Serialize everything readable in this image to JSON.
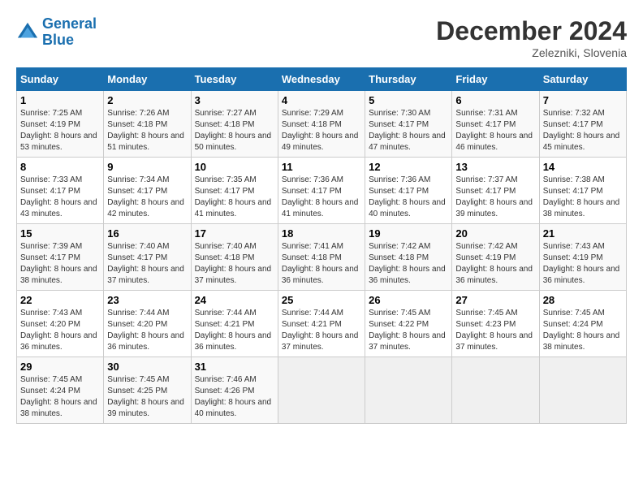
{
  "logo": {
    "line1": "General",
    "line2": "Blue"
  },
  "title": "December 2024",
  "subtitle": "Zelezniki, Slovenia",
  "days_header": [
    "Sunday",
    "Monday",
    "Tuesday",
    "Wednesday",
    "Thursday",
    "Friday",
    "Saturday"
  ],
  "weeks": [
    [
      {
        "num": "1",
        "sunrise": "Sunrise: 7:25 AM",
        "sunset": "Sunset: 4:19 PM",
        "daylight": "Daylight: 8 hours and 53 minutes."
      },
      {
        "num": "2",
        "sunrise": "Sunrise: 7:26 AM",
        "sunset": "Sunset: 4:18 PM",
        "daylight": "Daylight: 8 hours and 51 minutes."
      },
      {
        "num": "3",
        "sunrise": "Sunrise: 7:27 AM",
        "sunset": "Sunset: 4:18 PM",
        "daylight": "Daylight: 8 hours and 50 minutes."
      },
      {
        "num": "4",
        "sunrise": "Sunrise: 7:29 AM",
        "sunset": "Sunset: 4:18 PM",
        "daylight": "Daylight: 8 hours and 49 minutes."
      },
      {
        "num": "5",
        "sunrise": "Sunrise: 7:30 AM",
        "sunset": "Sunset: 4:17 PM",
        "daylight": "Daylight: 8 hours and 47 minutes."
      },
      {
        "num": "6",
        "sunrise": "Sunrise: 7:31 AM",
        "sunset": "Sunset: 4:17 PM",
        "daylight": "Daylight: 8 hours and 46 minutes."
      },
      {
        "num": "7",
        "sunrise": "Sunrise: 7:32 AM",
        "sunset": "Sunset: 4:17 PM",
        "daylight": "Daylight: 8 hours and 45 minutes."
      }
    ],
    [
      {
        "num": "8",
        "sunrise": "Sunrise: 7:33 AM",
        "sunset": "Sunset: 4:17 PM",
        "daylight": "Daylight: 8 hours and 43 minutes."
      },
      {
        "num": "9",
        "sunrise": "Sunrise: 7:34 AM",
        "sunset": "Sunset: 4:17 PM",
        "daylight": "Daylight: 8 hours and 42 minutes."
      },
      {
        "num": "10",
        "sunrise": "Sunrise: 7:35 AM",
        "sunset": "Sunset: 4:17 PM",
        "daylight": "Daylight: 8 hours and 41 minutes."
      },
      {
        "num": "11",
        "sunrise": "Sunrise: 7:36 AM",
        "sunset": "Sunset: 4:17 PM",
        "daylight": "Daylight: 8 hours and 41 minutes."
      },
      {
        "num": "12",
        "sunrise": "Sunrise: 7:36 AM",
        "sunset": "Sunset: 4:17 PM",
        "daylight": "Daylight: 8 hours and 40 minutes."
      },
      {
        "num": "13",
        "sunrise": "Sunrise: 7:37 AM",
        "sunset": "Sunset: 4:17 PM",
        "daylight": "Daylight: 8 hours and 39 minutes."
      },
      {
        "num": "14",
        "sunrise": "Sunrise: 7:38 AM",
        "sunset": "Sunset: 4:17 PM",
        "daylight": "Daylight: 8 hours and 38 minutes."
      }
    ],
    [
      {
        "num": "15",
        "sunrise": "Sunrise: 7:39 AM",
        "sunset": "Sunset: 4:17 PM",
        "daylight": "Daylight: 8 hours and 38 minutes."
      },
      {
        "num": "16",
        "sunrise": "Sunrise: 7:40 AM",
        "sunset": "Sunset: 4:17 PM",
        "daylight": "Daylight: 8 hours and 37 minutes."
      },
      {
        "num": "17",
        "sunrise": "Sunrise: 7:40 AM",
        "sunset": "Sunset: 4:18 PM",
        "daylight": "Daylight: 8 hours and 37 minutes."
      },
      {
        "num": "18",
        "sunrise": "Sunrise: 7:41 AM",
        "sunset": "Sunset: 4:18 PM",
        "daylight": "Daylight: 8 hours and 36 minutes."
      },
      {
        "num": "19",
        "sunrise": "Sunrise: 7:42 AM",
        "sunset": "Sunset: 4:18 PM",
        "daylight": "Daylight: 8 hours and 36 minutes."
      },
      {
        "num": "20",
        "sunrise": "Sunrise: 7:42 AM",
        "sunset": "Sunset: 4:19 PM",
        "daylight": "Daylight: 8 hours and 36 minutes."
      },
      {
        "num": "21",
        "sunrise": "Sunrise: 7:43 AM",
        "sunset": "Sunset: 4:19 PM",
        "daylight": "Daylight: 8 hours and 36 minutes."
      }
    ],
    [
      {
        "num": "22",
        "sunrise": "Sunrise: 7:43 AM",
        "sunset": "Sunset: 4:20 PM",
        "daylight": "Daylight: 8 hours and 36 minutes."
      },
      {
        "num": "23",
        "sunrise": "Sunrise: 7:44 AM",
        "sunset": "Sunset: 4:20 PM",
        "daylight": "Daylight: 8 hours and 36 minutes."
      },
      {
        "num": "24",
        "sunrise": "Sunrise: 7:44 AM",
        "sunset": "Sunset: 4:21 PM",
        "daylight": "Daylight: 8 hours and 36 minutes."
      },
      {
        "num": "25",
        "sunrise": "Sunrise: 7:44 AM",
        "sunset": "Sunset: 4:21 PM",
        "daylight": "Daylight: 8 hours and 37 minutes."
      },
      {
        "num": "26",
        "sunrise": "Sunrise: 7:45 AM",
        "sunset": "Sunset: 4:22 PM",
        "daylight": "Daylight: 8 hours and 37 minutes."
      },
      {
        "num": "27",
        "sunrise": "Sunrise: 7:45 AM",
        "sunset": "Sunset: 4:23 PM",
        "daylight": "Daylight: 8 hours and 37 minutes."
      },
      {
        "num": "28",
        "sunrise": "Sunrise: 7:45 AM",
        "sunset": "Sunset: 4:24 PM",
        "daylight": "Daylight: 8 hours and 38 minutes."
      }
    ],
    [
      {
        "num": "29",
        "sunrise": "Sunrise: 7:45 AM",
        "sunset": "Sunset: 4:24 PM",
        "daylight": "Daylight: 8 hours and 38 minutes."
      },
      {
        "num": "30",
        "sunrise": "Sunrise: 7:45 AM",
        "sunset": "Sunset: 4:25 PM",
        "daylight": "Daylight: 8 hours and 39 minutes."
      },
      {
        "num": "31",
        "sunrise": "Sunrise: 7:46 AM",
        "sunset": "Sunset: 4:26 PM",
        "daylight": "Daylight: 8 hours and 40 minutes."
      },
      null,
      null,
      null,
      null
    ]
  ]
}
